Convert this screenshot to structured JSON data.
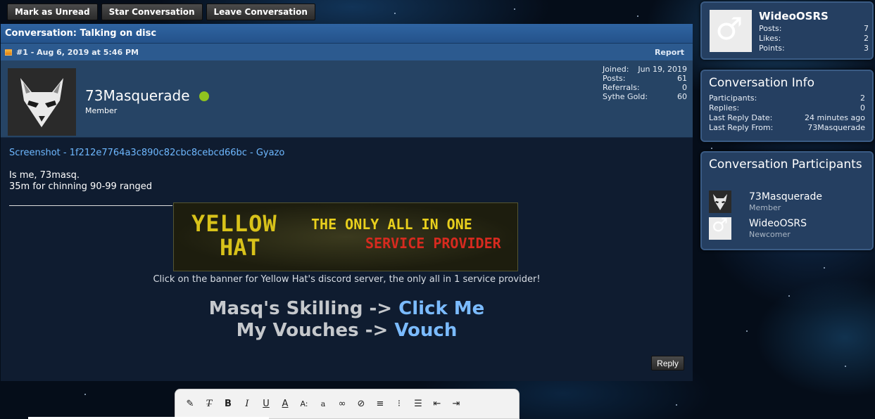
{
  "top_actions": {
    "mark_unread": "Mark as Unread",
    "star": "Star Conversation",
    "leave": "Leave Conversation"
  },
  "conversation": {
    "title": "Conversation: Talking on disc",
    "post_meta": "#1 - Aug 6, 2019 at 5:46 PM",
    "report": "Report",
    "author": {
      "name": "73Masquerade",
      "role": "Member",
      "stats": [
        {
          "label": "Joined:",
          "value": "Jun 19, 2019"
        },
        {
          "label": "Posts:",
          "value": "61"
        },
        {
          "label": "Referrals:",
          "value": "0"
        },
        {
          "label": "Sythe Gold:",
          "value": "60"
        }
      ]
    },
    "body": {
      "link": "Screenshot - 1f212e7764a3c890c82cbc8cebcd66bc - Gyazo",
      "line1": "Is me, 73masq.",
      "line2": "35m for chinning 90-99 ranged"
    },
    "signature": {
      "banner_word1": "YELLOW",
      "banner_word2": "HAT",
      "banner_tag1": "THE ONLY ALL IN ONE",
      "banner_tag2": "SERVICE PROVIDER",
      "caption": "Click on the banner for Yellow Hat's discord server, the only all in 1 service provider!",
      "line1_text": "Masq's Skilling -> ",
      "line1_link": "Click Me",
      "line2_text": "My Vouches -> ",
      "line2_link": "Vouch"
    },
    "reply": "Reply"
  },
  "sidebar": {
    "user": {
      "name": "WideoOSRS",
      "stats": [
        {
          "label": "Posts:",
          "value": "7"
        },
        {
          "label": "Likes:",
          "value": "2"
        },
        {
          "label": "Points:",
          "value": "3"
        }
      ]
    },
    "info": {
      "title": "Conversation Info",
      "rows": [
        {
          "label": "Participants:",
          "value": "2"
        },
        {
          "label": "Replies:",
          "value": "0"
        },
        {
          "label": "Last Reply Date:",
          "value": "24 minutes ago"
        },
        {
          "label": "Last Reply From:",
          "value": "73Masquerade"
        }
      ]
    },
    "participants": {
      "title": "Conversation Participants",
      "list": [
        {
          "name": "73Masquerade",
          "role": "Member"
        },
        {
          "name": "WideoOSRS",
          "role": "Newcomer"
        }
      ]
    }
  },
  "editor": {
    "tools": [
      "format-painter-icon",
      "remove-format-icon",
      "bold-icon",
      "italic-icon",
      "underline-icon",
      "text-color-icon",
      "font-size-icon",
      "font-family-icon",
      "link-icon",
      "unlink-icon",
      "align-icon",
      "bullet-list-icon",
      "numbered-list-icon",
      "outdent-icon",
      "indent-icon"
    ]
  }
}
